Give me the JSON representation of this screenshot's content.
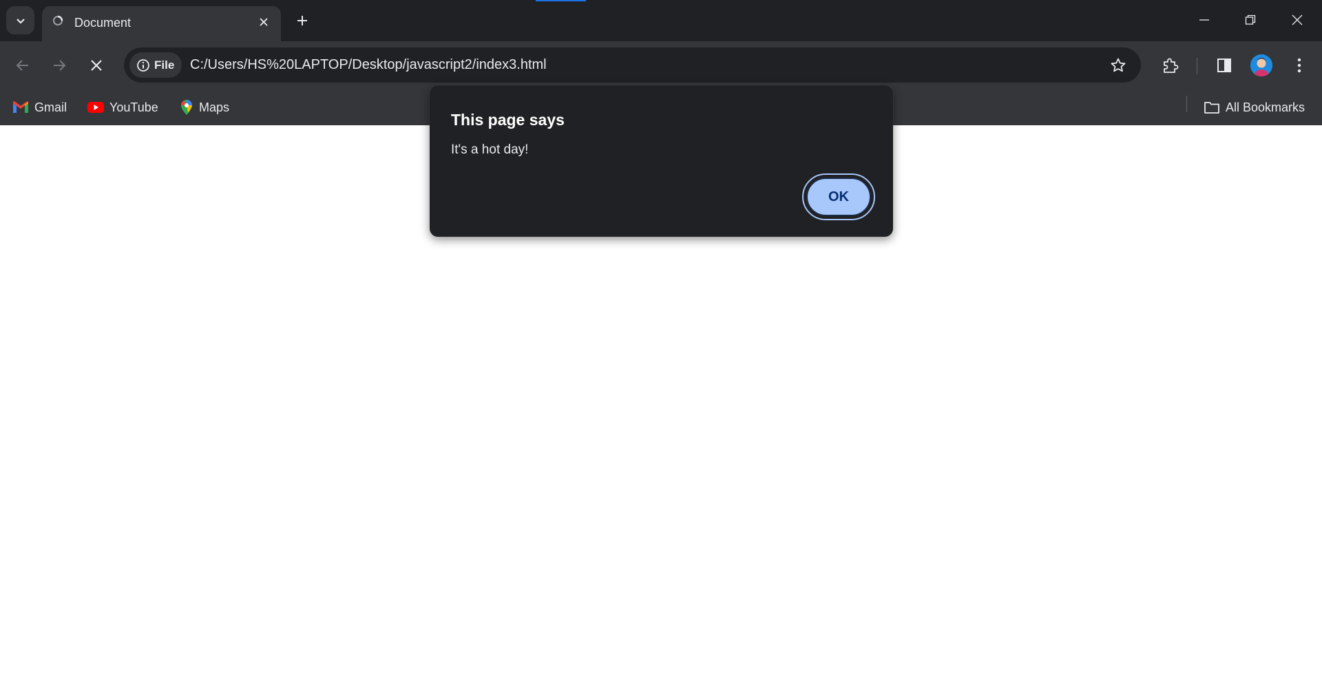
{
  "tab": {
    "title": "Document"
  },
  "address_bar": {
    "security_chip": "File",
    "url": "C:/Users/HS%20LAPTOP/Desktop/javascript2/index3.html"
  },
  "bookmarks": {
    "items": [
      {
        "label": "Gmail",
        "icon": "gmail-icon"
      },
      {
        "label": "YouTube",
        "icon": "youtube-icon"
      },
      {
        "label": "Maps",
        "icon": "maps-icon"
      }
    ],
    "all_bookmarks": "All Bookmarks"
  },
  "dialog": {
    "title": "This page says",
    "message": "It's a hot day!",
    "ok_label": "OK"
  },
  "colors": {
    "frame": "#202124",
    "toolbar": "#35363a",
    "accent": "#a8c7fa",
    "loading": "#1a73e8"
  }
}
